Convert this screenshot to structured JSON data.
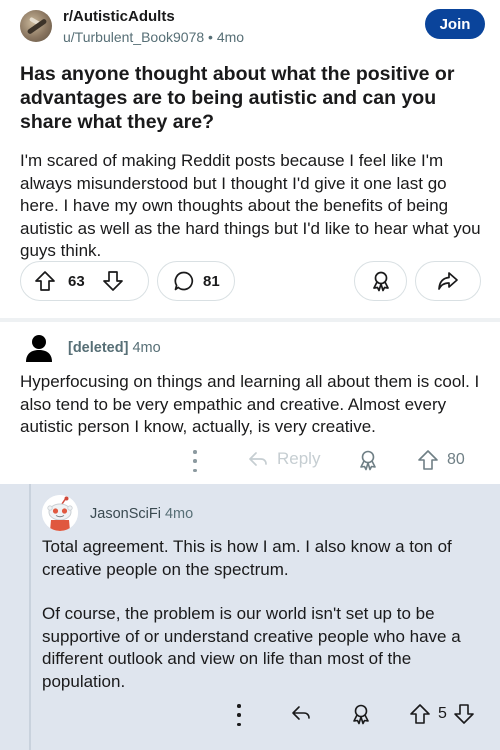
{
  "post": {
    "subreddit": "r/AutisticAdults",
    "author": "u/Turbulent_Book9078",
    "separator": "•",
    "age": "4mo",
    "join_label": "Join",
    "title": "Has anyone thought about what the positive or advantages are to being autistic and can you share what they are?",
    "body": "I'm scared of making Reddit posts because I feel like I'm always misunderstood but I thought I'd give it one last go here. I have my own thoughts about the benefits of being autistic as well as the hard things but I'd like to hear what you guys think.",
    "votes": "63",
    "comments": "81"
  },
  "comment1": {
    "author": "[deleted]",
    "age": "4mo",
    "body": "Hyperfocusing on things and learning all about them is cool. I also tend to be very empathic and creative. Almost every autistic person I know, actually, is very creative.",
    "reply_label": "Reply",
    "votes": "80"
  },
  "comment2": {
    "author": "JasonSciFi",
    "age": "4mo",
    "body_p1": "Total agreement. This is how I am. I also know a ton of creative people on the spectrum.",
    "body_p2": "Of course, the problem is our world isn't set up to be supportive of or understand creative people who have a different outlook and view on life than most of the population.",
    "votes": "5"
  },
  "colors": {
    "join_button": "#0a449b",
    "meta_text": "#576f76",
    "highlight_background": "#dfe5ee"
  }
}
